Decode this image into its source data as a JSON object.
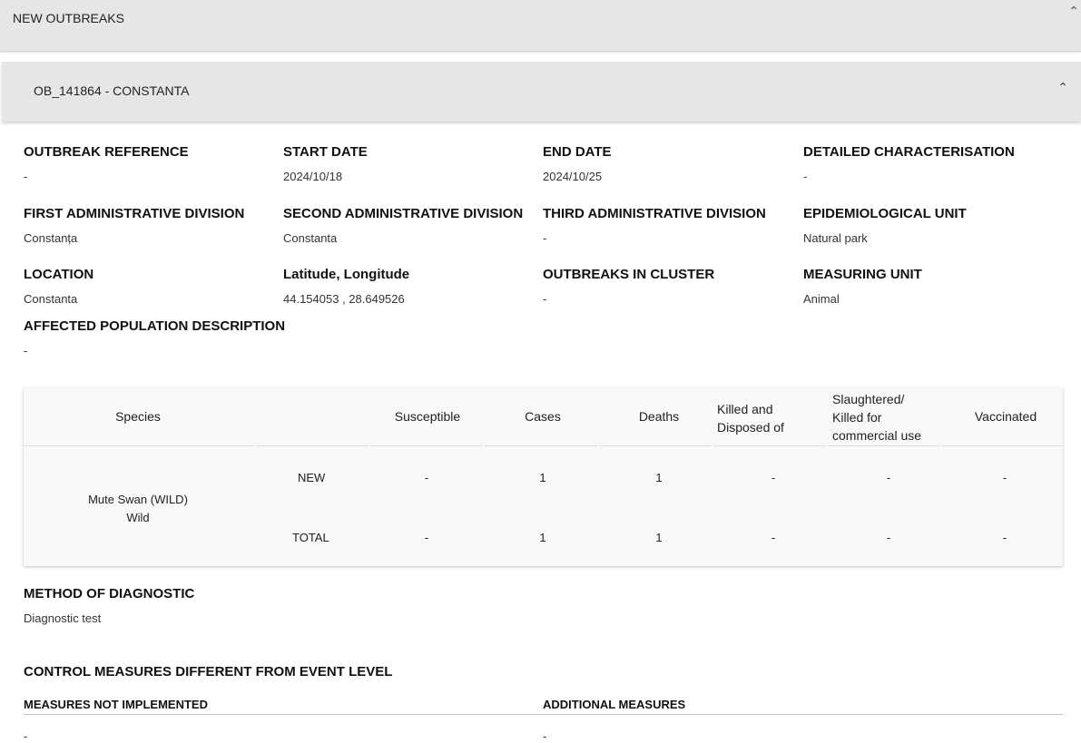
{
  "section": {
    "title": "NEW OUTBREAKS"
  },
  "outbreak": {
    "title": "OB_141864 - CONSTANTA",
    "fields": {
      "outbreak_reference": {
        "label": "OUTBREAK REFERENCE",
        "value": "-"
      },
      "start_date": {
        "label": "START DATE",
        "value": "2024/10/18"
      },
      "end_date": {
        "label": "END DATE",
        "value": "2024/10/25"
      },
      "detailed_characterisation": {
        "label": "DETAILED CHARACTERISATION",
        "value": "-"
      },
      "first_admin_division": {
        "label": "FIRST ADMINISTRATIVE DIVISION",
        "value": "Constanța"
      },
      "second_admin_division": {
        "label": "SECOND ADMINISTRATIVE DIVISION",
        "value": "Constanta"
      },
      "third_admin_division": {
        "label": "THIRD ADMINISTRATIVE DIVISION",
        "value": "-"
      },
      "epidemiological_unit": {
        "label": "EPIDEMIOLOGICAL UNIT",
        "value": "Natural park"
      },
      "location": {
        "label": "LOCATION",
        "value": "Constanta"
      },
      "lat_long": {
        "label": "Latitude, Longitude",
        "value": "44.154053 , 28.649526"
      },
      "outbreaks_in_cluster": {
        "label": "OUTBREAKS IN CLUSTER",
        "value": "-"
      },
      "measuring_unit": {
        "label": "MEASURING UNIT",
        "value": "Animal"
      },
      "affected_population": {
        "label": "AFFECTED POPULATION DESCRIPTION",
        "value": "-"
      }
    },
    "table": {
      "headers": {
        "species": "Species",
        "susceptible": "Susceptible",
        "cases": "Cases",
        "deaths": "Deaths",
        "killed_line1": "Killed and",
        "killed_line2": "Disposed of",
        "slaughtered_line1": "Slaughtered/",
        "slaughtered_line2": "Killed for",
        "slaughtered_line3": "commercial use",
        "vaccinated": "Vaccinated"
      },
      "species_name": "Mute Swan (WILD)",
      "species_type": "Wild",
      "rows": [
        {
          "label": "NEW",
          "susceptible": "-",
          "cases": "1",
          "deaths": "1",
          "killed": "-",
          "slaughtered": "-",
          "vaccinated": "-"
        },
        {
          "label": "TOTAL",
          "susceptible": "-",
          "cases": "1",
          "deaths": "1",
          "killed": "-",
          "slaughtered": "-",
          "vaccinated": "-"
        }
      ]
    },
    "method_of_diagnostic": {
      "label": "METHOD OF DIAGNOSTIC",
      "value": "Diagnostic test"
    },
    "control_measures": {
      "title": "CONTROL MEASURES DIFFERENT FROM EVENT LEVEL",
      "not_implemented_label": "MEASURES NOT IMPLEMENTED",
      "not_implemented_value": "-",
      "additional_label": "ADDITIONAL MEASURES",
      "additional_value": "-"
    }
  }
}
